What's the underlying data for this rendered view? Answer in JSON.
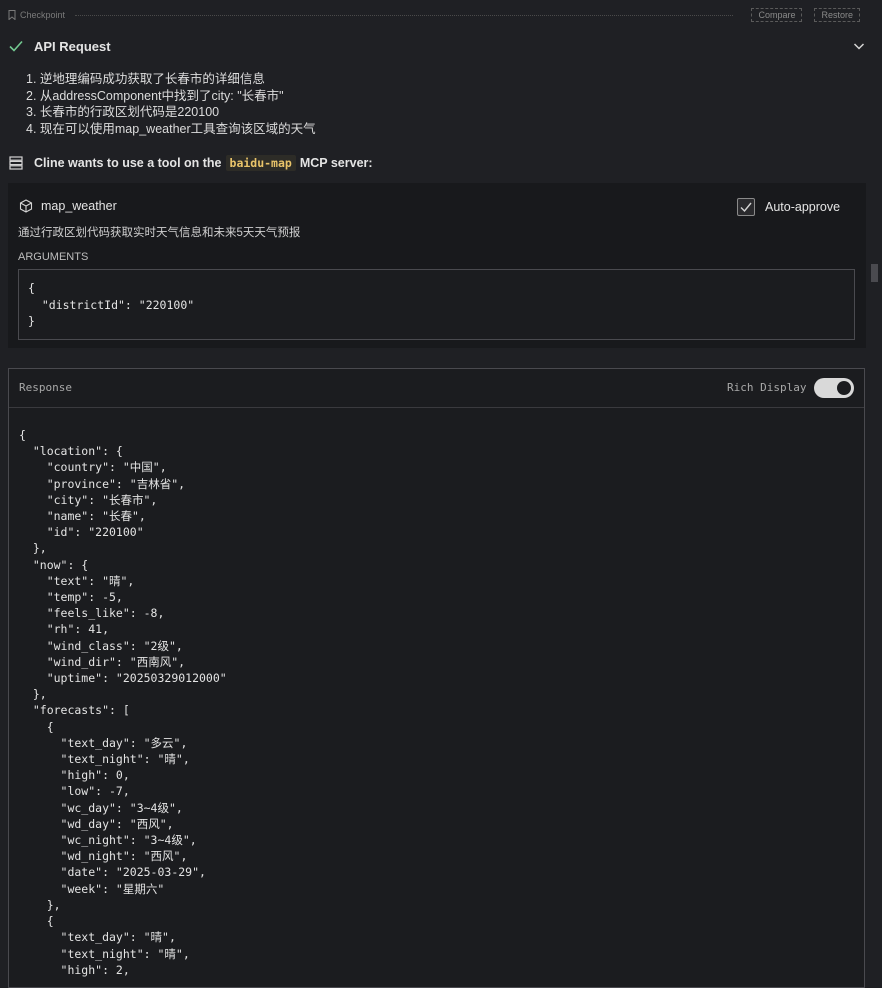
{
  "checkpoint": {
    "label": "Checkpoint",
    "compare_label": "Compare",
    "restore_label": "Restore"
  },
  "api_request": {
    "title": "API Request",
    "steps": [
      "1. 逆地理编码成功获取了长春市的详细信息",
      "2. 从addressComponent中找到了city: \"长春市\"",
      "3. 长春市的行政区划代码是220100",
      "4. 现在可以使用map_weather工具查询该区域的天气"
    ]
  },
  "tool_use": {
    "prefix": "Cline wants to use a tool on the",
    "server": "baidu-map",
    "suffix": "MCP server:"
  },
  "tool": {
    "name": "map_weather",
    "auto_approve_label": "Auto-approve",
    "auto_approve_checked": true,
    "description": "通过行政区划代码获取实时天气信息和未来5天天气预报",
    "arguments_label": "ARGUMENTS",
    "arguments_json": "{\n  \"districtId\": \"220100\"\n}"
  },
  "response": {
    "label": "Response",
    "rich_display_label": "Rich Display",
    "rich_display_on": true,
    "body": "{\n  \"location\": {\n    \"country\": \"中国\",\n    \"province\": \"吉林省\",\n    \"city\": \"长春市\",\n    \"name\": \"长春\",\n    \"id\": \"220100\"\n  },\n  \"now\": {\n    \"text\": \"晴\",\n    \"temp\": -5,\n    \"feels_like\": -8,\n    \"rh\": 41,\n    \"wind_class\": \"2级\",\n    \"wind_dir\": \"西南风\",\n    \"uptime\": \"20250329012000\"\n  },\n  \"forecasts\": [\n    {\n      \"text_day\": \"多云\",\n      \"text_night\": \"晴\",\n      \"high\": 0,\n      \"low\": -7,\n      \"wc_day\": \"3~4级\",\n      \"wd_day\": \"西风\",\n      \"wc_night\": \"3~4级\",\n      \"wd_night\": \"西风\",\n      \"date\": \"2025-03-29\",\n      \"week\": \"星期六\"\n    },\n    {\n      \"text_day\": \"晴\",\n      \"text_night\": \"晴\",\n      \"high\": 2,"
  },
  "colors": {
    "background": "#1f2024",
    "success": "#73c991",
    "server_chip": "#e9c46a"
  }
}
